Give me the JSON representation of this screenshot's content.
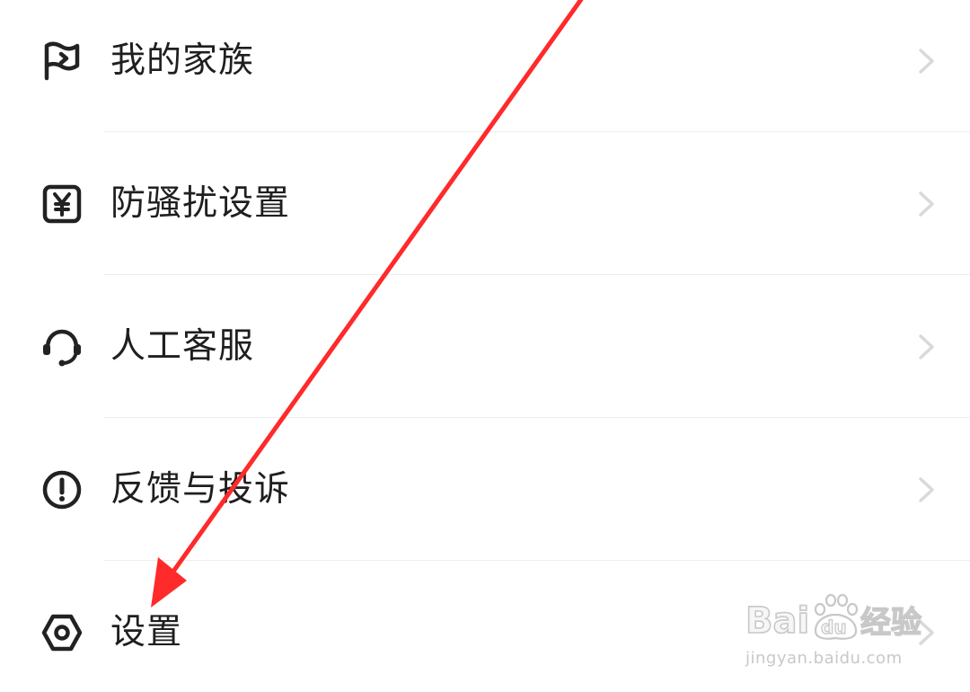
{
  "menu": {
    "items": [
      {
        "label": "我的家族",
        "icon": "flag-icon"
      },
      {
        "label": "防骚扰设置",
        "icon": "yen-box-icon"
      },
      {
        "label": "人工客服",
        "icon": "headset-icon"
      },
      {
        "label": "反馈与投诉",
        "icon": "exclamation-circle-icon"
      },
      {
        "label": "设置",
        "icon": "settings-hex-icon"
      }
    ]
  },
  "annotation": {
    "arrow_color": "#ff2a2a"
  },
  "watermark": {
    "brand": "Baidu经验",
    "url": "jingyan.baidu.com"
  },
  "colors": {
    "text": "#1f1f1f",
    "chevron": "#d9d9d9",
    "divider": "#eeeeee",
    "arrow": "#ff2a2a"
  }
}
